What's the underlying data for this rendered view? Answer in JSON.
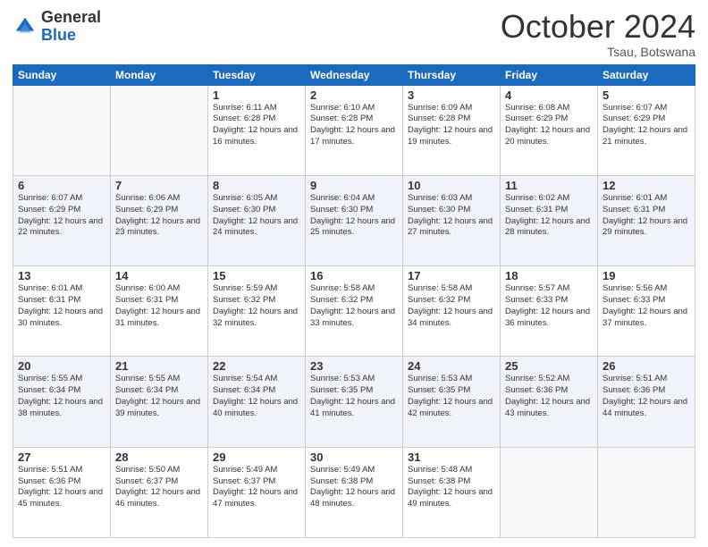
{
  "header": {
    "logo": {
      "general": "General",
      "blue": "Blue"
    },
    "title": "October 2024",
    "subtitle": "Tsau, Botswana"
  },
  "weekdays": [
    "Sunday",
    "Monday",
    "Tuesday",
    "Wednesday",
    "Thursday",
    "Friday",
    "Saturday"
  ],
  "weeks": [
    [
      {
        "day": "",
        "empty": true
      },
      {
        "day": "",
        "empty": true
      },
      {
        "day": "1",
        "sunrise": "6:11 AM",
        "sunset": "6:28 PM",
        "daylight": "12 hours and 16 minutes."
      },
      {
        "day": "2",
        "sunrise": "6:10 AM",
        "sunset": "6:28 PM",
        "daylight": "12 hours and 17 minutes."
      },
      {
        "day": "3",
        "sunrise": "6:09 AM",
        "sunset": "6:28 PM",
        "daylight": "12 hours and 19 minutes."
      },
      {
        "day": "4",
        "sunrise": "6:08 AM",
        "sunset": "6:29 PM",
        "daylight": "12 hours and 20 minutes."
      },
      {
        "day": "5",
        "sunrise": "6:07 AM",
        "sunset": "6:29 PM",
        "daylight": "12 hours and 21 minutes."
      }
    ],
    [
      {
        "day": "6",
        "sunrise": "6:07 AM",
        "sunset": "6:29 PM",
        "daylight": "12 hours and 22 minutes."
      },
      {
        "day": "7",
        "sunrise": "6:06 AM",
        "sunset": "6:29 PM",
        "daylight": "12 hours and 23 minutes."
      },
      {
        "day": "8",
        "sunrise": "6:05 AM",
        "sunset": "6:30 PM",
        "daylight": "12 hours and 24 minutes."
      },
      {
        "day": "9",
        "sunrise": "6:04 AM",
        "sunset": "6:30 PM",
        "daylight": "12 hours and 25 minutes."
      },
      {
        "day": "10",
        "sunrise": "6:03 AM",
        "sunset": "6:30 PM",
        "daylight": "12 hours and 27 minutes."
      },
      {
        "day": "11",
        "sunrise": "6:02 AM",
        "sunset": "6:31 PM",
        "daylight": "12 hours and 28 minutes."
      },
      {
        "day": "12",
        "sunrise": "6:01 AM",
        "sunset": "6:31 PM",
        "daylight": "12 hours and 29 minutes."
      }
    ],
    [
      {
        "day": "13",
        "sunrise": "6:01 AM",
        "sunset": "6:31 PM",
        "daylight": "12 hours and 30 minutes."
      },
      {
        "day": "14",
        "sunrise": "6:00 AM",
        "sunset": "6:31 PM",
        "daylight": "12 hours and 31 minutes."
      },
      {
        "day": "15",
        "sunrise": "5:59 AM",
        "sunset": "6:32 PM",
        "daylight": "12 hours and 32 minutes."
      },
      {
        "day": "16",
        "sunrise": "5:58 AM",
        "sunset": "6:32 PM",
        "daylight": "12 hours and 33 minutes."
      },
      {
        "day": "17",
        "sunrise": "5:58 AM",
        "sunset": "6:32 PM",
        "daylight": "12 hours and 34 minutes."
      },
      {
        "day": "18",
        "sunrise": "5:57 AM",
        "sunset": "6:33 PM",
        "daylight": "12 hours and 36 minutes."
      },
      {
        "day": "19",
        "sunrise": "5:56 AM",
        "sunset": "6:33 PM",
        "daylight": "12 hours and 37 minutes."
      }
    ],
    [
      {
        "day": "20",
        "sunrise": "5:55 AM",
        "sunset": "6:34 PM",
        "daylight": "12 hours and 38 minutes."
      },
      {
        "day": "21",
        "sunrise": "5:55 AM",
        "sunset": "6:34 PM",
        "daylight": "12 hours and 39 minutes."
      },
      {
        "day": "22",
        "sunrise": "5:54 AM",
        "sunset": "6:34 PM",
        "daylight": "12 hours and 40 minutes."
      },
      {
        "day": "23",
        "sunrise": "5:53 AM",
        "sunset": "6:35 PM",
        "daylight": "12 hours and 41 minutes."
      },
      {
        "day": "24",
        "sunrise": "5:53 AM",
        "sunset": "6:35 PM",
        "daylight": "12 hours and 42 minutes."
      },
      {
        "day": "25",
        "sunrise": "5:52 AM",
        "sunset": "6:36 PM",
        "daylight": "12 hours and 43 minutes."
      },
      {
        "day": "26",
        "sunrise": "5:51 AM",
        "sunset": "6:36 PM",
        "daylight": "12 hours and 44 minutes."
      }
    ],
    [
      {
        "day": "27",
        "sunrise": "5:51 AM",
        "sunset": "6:36 PM",
        "daylight": "12 hours and 45 minutes."
      },
      {
        "day": "28",
        "sunrise": "5:50 AM",
        "sunset": "6:37 PM",
        "daylight": "12 hours and 46 minutes."
      },
      {
        "day": "29",
        "sunrise": "5:49 AM",
        "sunset": "6:37 PM",
        "daylight": "12 hours and 47 minutes."
      },
      {
        "day": "30",
        "sunrise": "5:49 AM",
        "sunset": "6:38 PM",
        "daylight": "12 hours and 48 minutes."
      },
      {
        "day": "31",
        "sunrise": "5:48 AM",
        "sunset": "6:38 PM",
        "daylight": "12 hours and 49 minutes."
      },
      {
        "day": "",
        "empty": true
      },
      {
        "day": "",
        "empty": true
      }
    ]
  ],
  "labels": {
    "sunrise_prefix": "Sunrise: ",
    "sunset_prefix": "Sunset: ",
    "daylight_prefix": "Daylight: "
  }
}
